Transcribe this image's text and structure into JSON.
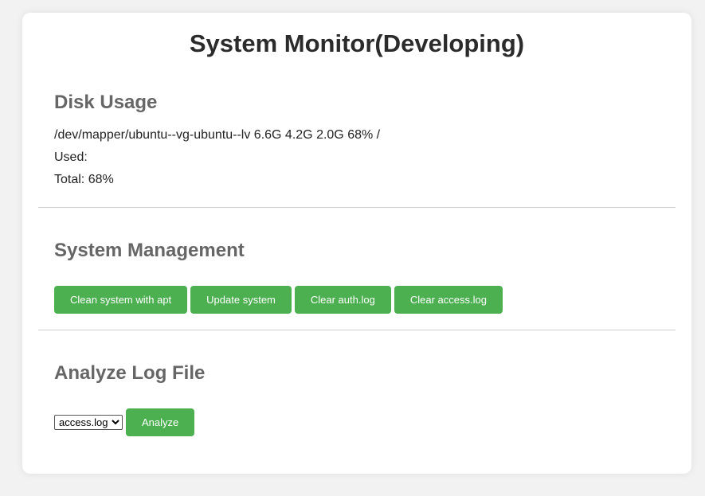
{
  "page": {
    "title": "System Monitor(Developing)"
  },
  "disk": {
    "heading": "Disk Usage",
    "line": "/dev/mapper/ubuntu--vg-ubuntu--lv 6.6G 4.2G 2.0G 68% /",
    "used": "Used:",
    "total": "Total: 68%"
  },
  "management": {
    "heading": "System Management",
    "buttons": [
      {
        "label": "Clean system with apt"
      },
      {
        "label": "Update system"
      },
      {
        "label": "Clear auth.log"
      },
      {
        "label": "Clear access.log"
      }
    ]
  },
  "log": {
    "heading": "Analyze Log File",
    "selected": "access.log",
    "analyze_label": "Analyze"
  },
  "colors": {
    "accent": "#4caf50",
    "heading": "#666666",
    "background": "#f2f2f2",
    "card": "#ffffff"
  }
}
